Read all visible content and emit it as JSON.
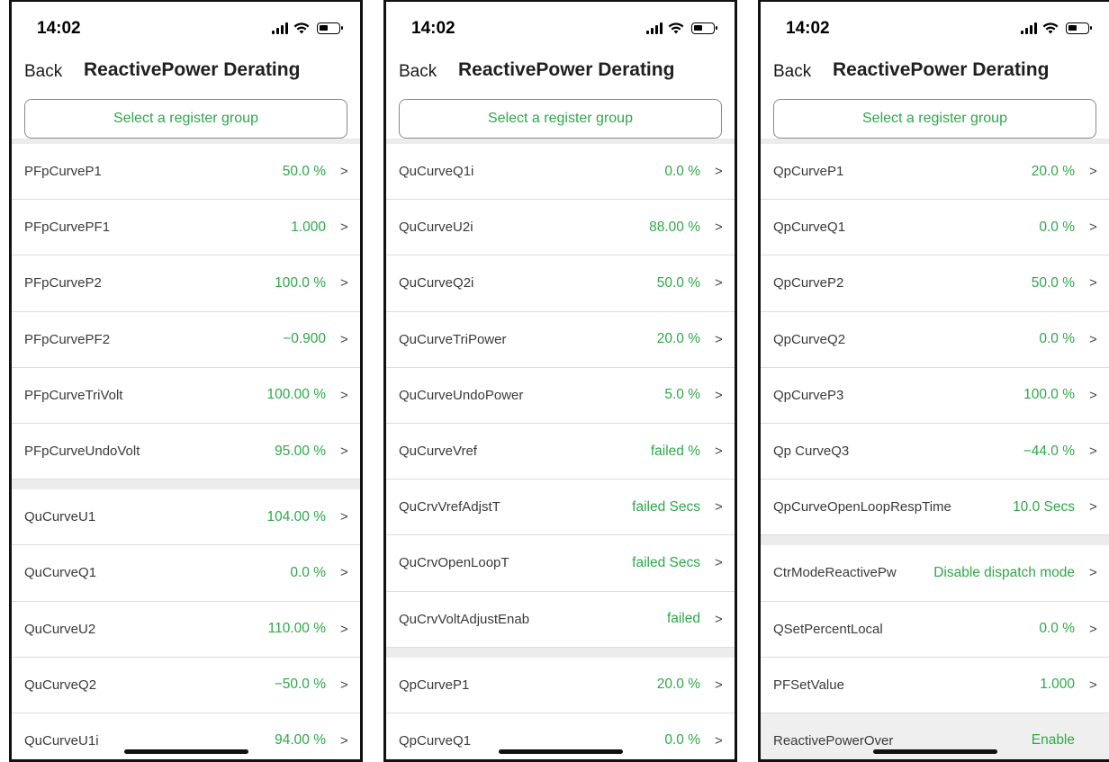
{
  "status": {
    "time": "14:02"
  },
  "nav": {
    "back_label": "Back",
    "title": "ReactivePower Derating"
  },
  "select_group_label": "Select a register group",
  "colors": {
    "accent": "#2ea84a",
    "text": "#3a3a3a",
    "divider": "#dcdcdc"
  },
  "icons": {
    "chevron": ">"
  },
  "screens": [
    {
      "items": [
        {
          "label": "PFpCurveP1",
          "value": "50.0 %"
        },
        {
          "label": "PFpCurvePF1",
          "value": "1.000"
        },
        {
          "label": "PFpCurveP2",
          "value": "100.0 %"
        },
        {
          "label": "PFpCurvePF2",
          "value": "−0.900"
        },
        {
          "label": "PFpCurveTriVolt",
          "value": "100.00 %"
        },
        {
          "label": "PFpCurveUndoVolt",
          "value": "95.00 %"
        },
        {
          "label": "QuCurveU1",
          "value": "104.00 %"
        },
        {
          "label": "QuCurveQ1",
          "value": "0.0 %"
        },
        {
          "label": "QuCurveU2",
          "value": "110.00 %"
        },
        {
          "label": "QuCurveQ2",
          "value": "−50.0 %"
        },
        {
          "label": "QuCurveU1i",
          "value": "94.00 %"
        }
      ]
    },
    {
      "items": [
        {
          "label": "QuCurveQ1i",
          "value": "0.0 %"
        },
        {
          "label": "QuCurveU2i",
          "value": "88.00 %"
        },
        {
          "label": "QuCurveQ2i",
          "value": "50.0 %"
        },
        {
          "label": "QuCurveTriPower",
          "value": "20.0 %"
        },
        {
          "label": "QuCurveUndoPower",
          "value": "5.0 %"
        },
        {
          "label": "QuCurveVref",
          "value": "failed %"
        },
        {
          "label": "QuCrvVrefAdjstT",
          "value": "failed Secs"
        },
        {
          "label": "QuCrvOpenLoopT",
          "value": "failed Secs"
        },
        {
          "label": "QuCrvVoltAdjustEnab",
          "value": "failed"
        },
        {
          "label": "QpCurveP1",
          "value": "20.0 %"
        },
        {
          "label": "QpCurveQ1",
          "value": "0.0 %"
        }
      ]
    },
    {
      "items": [
        {
          "label": "QpCurveP1",
          "value": "20.0 %"
        },
        {
          "label": "QpCurveQ1",
          "value": "0.0 %"
        },
        {
          "label": "QpCurveP2",
          "value": "50.0 %"
        },
        {
          "label": "QpCurveQ2",
          "value": "0.0 %"
        },
        {
          "label": "QpCurveP3",
          "value": "100.0 %"
        },
        {
          "label": "Qp CurveQ3",
          "value": "−44.0 %"
        },
        {
          "label": "QpCurveOpenLoopRespTime",
          "value": "10.0 Secs"
        },
        {
          "label": "CtrModeReactivePw",
          "value": "Disable dispatch mode"
        },
        {
          "label": "QSetPercentLocal",
          "value": "0.0 %"
        },
        {
          "label": "PFSetValue",
          "value": "1.000"
        },
        {
          "label": "ReactivePowerOver",
          "value": "Enable"
        }
      ]
    }
  ]
}
